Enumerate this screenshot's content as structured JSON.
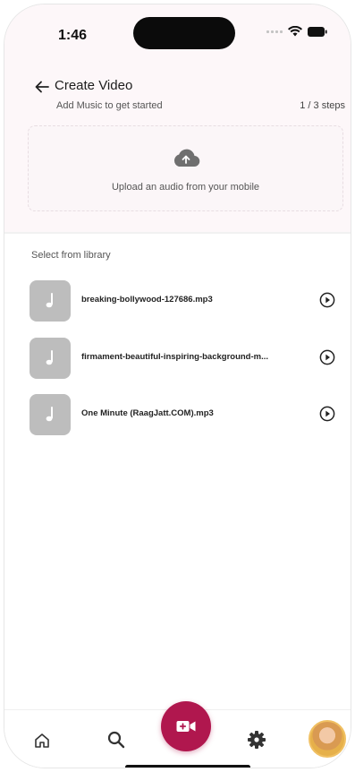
{
  "status_bar": {
    "time": "1:46"
  },
  "header": {
    "title": "Create Video",
    "subtitle": "Add Music to get started",
    "steps": "1 / 3 steps"
  },
  "upload": {
    "text": "Upload an audio from your mobile"
  },
  "library": {
    "label": "Select from library",
    "tracks": [
      {
        "name": "breaking-bollywood-127686.mp3"
      },
      {
        "name": "firmament-beautiful-inspiring-background-m..."
      },
      {
        "name": "One Minute (RaagJatt.COM).mp3"
      }
    ]
  },
  "nav": {
    "items": [
      "home-icon",
      "search-icon",
      "video-camera-icon",
      "gear-icon",
      "avatar"
    ]
  },
  "colors": {
    "accent": "#b0174e",
    "thumb": "#bdbdbd",
    "header_bg": "#fdf7f9"
  }
}
